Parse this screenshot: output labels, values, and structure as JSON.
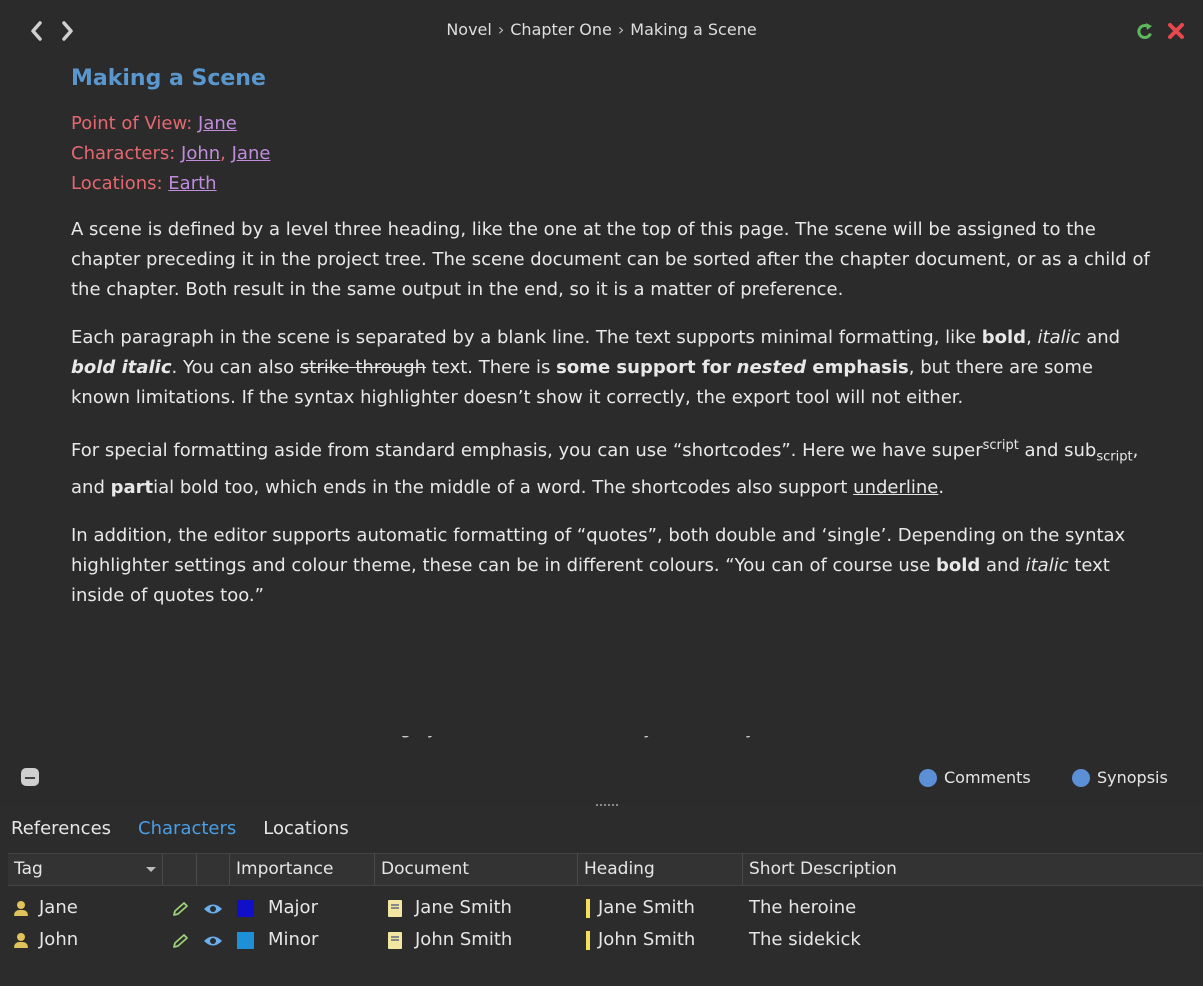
{
  "breadcrumb": [
    "Novel",
    "Chapter One",
    "Making a Scene"
  ],
  "breadcrumb_sep": "›",
  "doc": {
    "title": "Making a Scene",
    "pov_label": "Point of View: ",
    "pov": "Jane",
    "characters_label": "Characters: ",
    "characters": [
      "John",
      "Jane"
    ],
    "locations_label": "Locations: ",
    "locations": "Earth",
    "p1": "A scene is defined by a level three heading, like the one at the top of this page. The scene will be assigned to the chapter preceding it in the project tree. The scene document can be sorted after the chapter document, or as a child of the chapter. Both result in the same output in the end, so it is a matter of preference.",
    "p2": {
      "a": "Each paragraph in the scene is separated by a blank line. The text supports minimal formatting, like ",
      "bold": "bold",
      "b": ", ",
      "italic": "italic",
      "c": " and ",
      "bold_italic": "bold italic",
      "d": ". You can also ",
      "strike": "strike through",
      "e": " text. There is ",
      "bold2": "some support for",
      "nested": "nested",
      "emph": " emphasis",
      "f": ", but there are some known limitations. If the syntax highlighter doesn’t show it correctly, the export tool will not either."
    },
    "p3": {
      "a": "For special formatting aside from standard emphasis, you can use “shortcodes”. Here we have super",
      "sup": "script",
      "b": " and sub",
      "sub": "script",
      "c": ", and ",
      "part": "part",
      "d": "ial bold too, which ends in the middle of a word. The shortcodes also support ",
      "underline": "underline",
      "e": "."
    },
    "p4": {
      "a": "In addition, the editor supports automatic formatting of “quotes”, both double and ‘single’. Depending on the syntax highlighter settings and colour theme, these can be in different colours. “You can of course use ",
      "bold": "bold",
      "b": " and ",
      "italic": "italic",
      "c": " text inside of quotes too.”"
    },
    "p5_partial": "Of course, there are a few other things you can do with ... the syntax, and you can read all about it in the documentation ..."
  },
  "footer": {
    "comments": "Comments",
    "synopsis": "Synopsis"
  },
  "tabs": [
    "References",
    "Characters",
    "Locations"
  ],
  "active_tab": "Characters",
  "table": {
    "headers": {
      "tag": "Tag",
      "importance": "Importance",
      "document": "Document",
      "heading": "Heading",
      "short_description": "Short Description"
    },
    "rows": [
      {
        "tag": "Jane",
        "importance": "Major",
        "importance_color": "#1010c8",
        "document": "Jane Smith",
        "heading": "Jane Smith",
        "description": "The heroine"
      },
      {
        "tag": "John",
        "importance": "Minor",
        "importance_color": "#1e90d8",
        "document": "John Smith",
        "heading": "John Smith",
        "description": "The sidekick"
      }
    ]
  },
  "colors": {
    "title": "#5b97cf",
    "meta": "#e56870",
    "link": "#c08ddd",
    "active_tab": "#4a9ee6",
    "refresh": "#5cb85c",
    "close": "#e8474e"
  }
}
